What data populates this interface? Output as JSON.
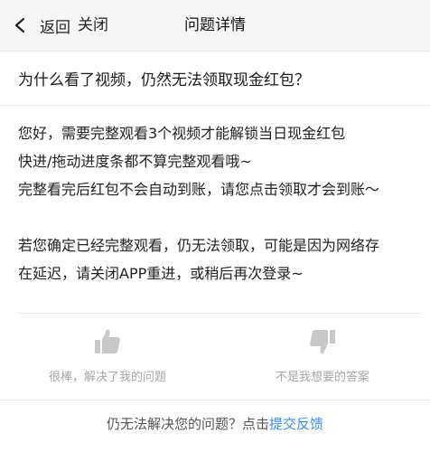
{
  "nav": {
    "back_label": "返回",
    "close_label": "关闭",
    "title": "问题详情"
  },
  "question": {
    "text": "为什么看了视频，仍然无法领取现金红包？"
  },
  "answer": {
    "lines": [
      "您好，需要完整观看3个视频才能解锁当日现金红包",
      "快进/拖动进度条都不算完整观看哦~",
      "完整看完后红包不会自动到账，请您点击领取才会到账～",
      "",
      "若您确定已经完整观看，仍无法领取，可能是因为网络存",
      "在延迟，请关闭APP重进，或稍后再次登录~"
    ]
  },
  "feedback": {
    "helpful_label": "很棒，解决了我的问题",
    "helpful_icon": "thumbs-up-icon",
    "not_helpful_label": "不是我想要的答案",
    "not_helpful_icon": "thumbs-down-icon"
  },
  "footer": {
    "prompt": "仍无法解决您的问题？点击",
    "link_label": "提交反馈"
  },
  "colors": {
    "link": "#3a8ee6",
    "icon": "#c8c8c8",
    "muted_text": "#a6a6a6"
  }
}
